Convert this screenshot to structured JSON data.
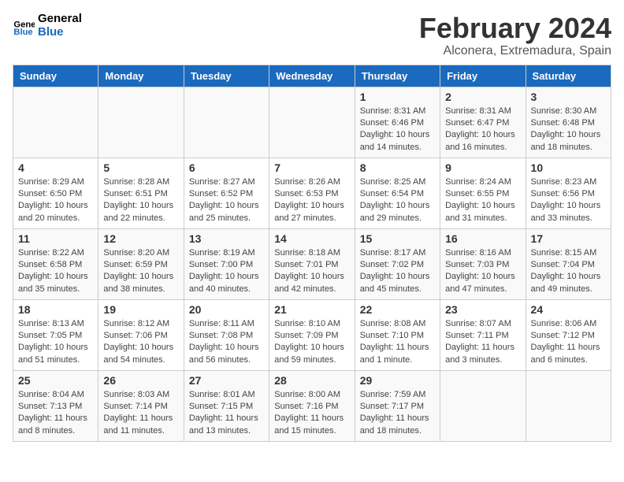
{
  "header": {
    "logo_line1": "General",
    "logo_line2": "Blue",
    "month_year": "February 2024",
    "location": "Alconera, Extremadura, Spain"
  },
  "days_of_week": [
    "Sunday",
    "Monday",
    "Tuesday",
    "Wednesday",
    "Thursday",
    "Friday",
    "Saturday"
  ],
  "weeks": [
    [
      {
        "day": "",
        "info": ""
      },
      {
        "day": "",
        "info": ""
      },
      {
        "day": "",
        "info": ""
      },
      {
        "day": "",
        "info": ""
      },
      {
        "day": "1",
        "info": "Sunrise: 8:31 AM\nSunset: 6:46 PM\nDaylight: 10 hours and 14 minutes."
      },
      {
        "day": "2",
        "info": "Sunrise: 8:31 AM\nSunset: 6:47 PM\nDaylight: 10 hours and 16 minutes."
      },
      {
        "day": "3",
        "info": "Sunrise: 8:30 AM\nSunset: 6:48 PM\nDaylight: 10 hours and 18 minutes."
      }
    ],
    [
      {
        "day": "4",
        "info": "Sunrise: 8:29 AM\nSunset: 6:50 PM\nDaylight: 10 hours and 20 minutes."
      },
      {
        "day": "5",
        "info": "Sunrise: 8:28 AM\nSunset: 6:51 PM\nDaylight: 10 hours and 22 minutes."
      },
      {
        "day": "6",
        "info": "Sunrise: 8:27 AM\nSunset: 6:52 PM\nDaylight: 10 hours and 25 minutes."
      },
      {
        "day": "7",
        "info": "Sunrise: 8:26 AM\nSunset: 6:53 PM\nDaylight: 10 hours and 27 minutes."
      },
      {
        "day": "8",
        "info": "Sunrise: 8:25 AM\nSunset: 6:54 PM\nDaylight: 10 hours and 29 minutes."
      },
      {
        "day": "9",
        "info": "Sunrise: 8:24 AM\nSunset: 6:55 PM\nDaylight: 10 hours and 31 minutes."
      },
      {
        "day": "10",
        "info": "Sunrise: 8:23 AM\nSunset: 6:56 PM\nDaylight: 10 hours and 33 minutes."
      }
    ],
    [
      {
        "day": "11",
        "info": "Sunrise: 8:22 AM\nSunset: 6:58 PM\nDaylight: 10 hours and 35 minutes."
      },
      {
        "day": "12",
        "info": "Sunrise: 8:20 AM\nSunset: 6:59 PM\nDaylight: 10 hours and 38 minutes."
      },
      {
        "day": "13",
        "info": "Sunrise: 8:19 AM\nSunset: 7:00 PM\nDaylight: 10 hours and 40 minutes."
      },
      {
        "day": "14",
        "info": "Sunrise: 8:18 AM\nSunset: 7:01 PM\nDaylight: 10 hours and 42 minutes."
      },
      {
        "day": "15",
        "info": "Sunrise: 8:17 AM\nSunset: 7:02 PM\nDaylight: 10 hours and 45 minutes."
      },
      {
        "day": "16",
        "info": "Sunrise: 8:16 AM\nSunset: 7:03 PM\nDaylight: 10 hours and 47 minutes."
      },
      {
        "day": "17",
        "info": "Sunrise: 8:15 AM\nSunset: 7:04 PM\nDaylight: 10 hours and 49 minutes."
      }
    ],
    [
      {
        "day": "18",
        "info": "Sunrise: 8:13 AM\nSunset: 7:05 PM\nDaylight: 10 hours and 51 minutes."
      },
      {
        "day": "19",
        "info": "Sunrise: 8:12 AM\nSunset: 7:06 PM\nDaylight: 10 hours and 54 minutes."
      },
      {
        "day": "20",
        "info": "Sunrise: 8:11 AM\nSunset: 7:08 PM\nDaylight: 10 hours and 56 minutes."
      },
      {
        "day": "21",
        "info": "Sunrise: 8:10 AM\nSunset: 7:09 PM\nDaylight: 10 hours and 59 minutes."
      },
      {
        "day": "22",
        "info": "Sunrise: 8:08 AM\nSunset: 7:10 PM\nDaylight: 11 hours and 1 minute."
      },
      {
        "day": "23",
        "info": "Sunrise: 8:07 AM\nSunset: 7:11 PM\nDaylight: 11 hours and 3 minutes."
      },
      {
        "day": "24",
        "info": "Sunrise: 8:06 AM\nSunset: 7:12 PM\nDaylight: 11 hours and 6 minutes."
      }
    ],
    [
      {
        "day": "25",
        "info": "Sunrise: 8:04 AM\nSunset: 7:13 PM\nDaylight: 11 hours and 8 minutes."
      },
      {
        "day": "26",
        "info": "Sunrise: 8:03 AM\nSunset: 7:14 PM\nDaylight: 11 hours and 11 minutes."
      },
      {
        "day": "27",
        "info": "Sunrise: 8:01 AM\nSunset: 7:15 PM\nDaylight: 11 hours and 13 minutes."
      },
      {
        "day": "28",
        "info": "Sunrise: 8:00 AM\nSunset: 7:16 PM\nDaylight: 11 hours and 15 minutes."
      },
      {
        "day": "29",
        "info": "Sunrise: 7:59 AM\nSunset: 7:17 PM\nDaylight: 11 hours and 18 minutes."
      },
      {
        "day": "",
        "info": ""
      },
      {
        "day": "",
        "info": ""
      }
    ]
  ]
}
